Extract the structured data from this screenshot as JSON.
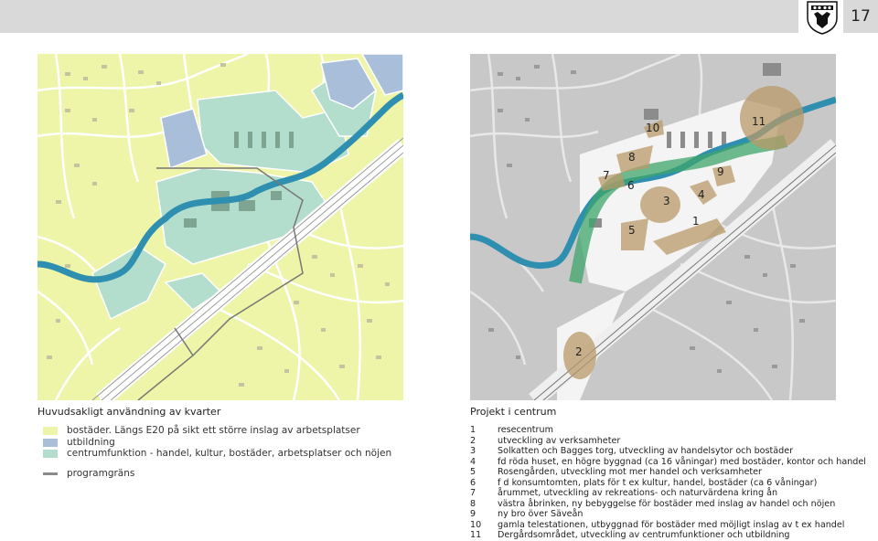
{
  "page_number": "17",
  "left_map": {
    "title": "Huvudsakligt användning av kvarter",
    "legend": [
      {
        "color": "#eef5a8",
        "label": "bostäder. Längs E20 på sikt ett större inslag av arbetsplatser"
      },
      {
        "color": "#a9bfd9",
        "label": "utbildning"
      },
      {
        "color": "#b3ddcc",
        "label": "centrumfunktion - handel, kultur, bostäder, arbetsplatser och nöjen"
      },
      {
        "color": "#8a8a8a",
        "label": "programgräns",
        "type": "line"
      }
    ]
  },
  "right_map": {
    "title": "Projekt i centrum",
    "labels": [
      "1",
      "2",
      "3",
      "4",
      "5",
      "6",
      "7",
      "8",
      "9",
      "10",
      "11"
    ],
    "projects": [
      {
        "num": "1",
        "text": "resecentrum"
      },
      {
        "num": "2",
        "text": "utveckling av verksamheter"
      },
      {
        "num": "3",
        "text": "Solkatten och Bagges torg, utveckling av handelsytor och bostäder"
      },
      {
        "num": "4",
        "text": "fd röda huset, en högre byggnad (ca 16 våningar) med bostäder, kontor och handel"
      },
      {
        "num": "5",
        "text": "Rosengården, utveckling mot mer handel och verksamheter"
      },
      {
        "num": "6",
        "text": "f d konsumtomten, plats för t ex kultur, handel, bostäder (ca 6 våningar)"
      },
      {
        "num": "7",
        "text": "årummet, utveckling av rekreations- och naturvärdena kring ån"
      },
      {
        "num": "8",
        "text": "västra åbrinken, ny bebyggelse för bostäder med inslag av handel och nöjen"
      },
      {
        "num": "9",
        "text": "ny bro över Säveån"
      },
      {
        "num": "10",
        "text": "gamla telestationen, utbyggnad för bostäder med möjligt inslag av t ex handel"
      },
      {
        "num": "11",
        "text": "Dergårdsområdet, utveckling av centrumfunktioner och utbildning"
      }
    ]
  },
  "colors": {
    "housing": "#eef5a8",
    "education": "#a9bfd9",
    "center": "#b3ddcc",
    "river": "#2f8fb0",
    "project_area": "#b89a68",
    "green_corridor": "#3fa56b",
    "map_gray": "#c8c8c8",
    "header": "#d9d9d9"
  },
  "icons": [
    "municipal-coat-of-arms-icon"
  ]
}
